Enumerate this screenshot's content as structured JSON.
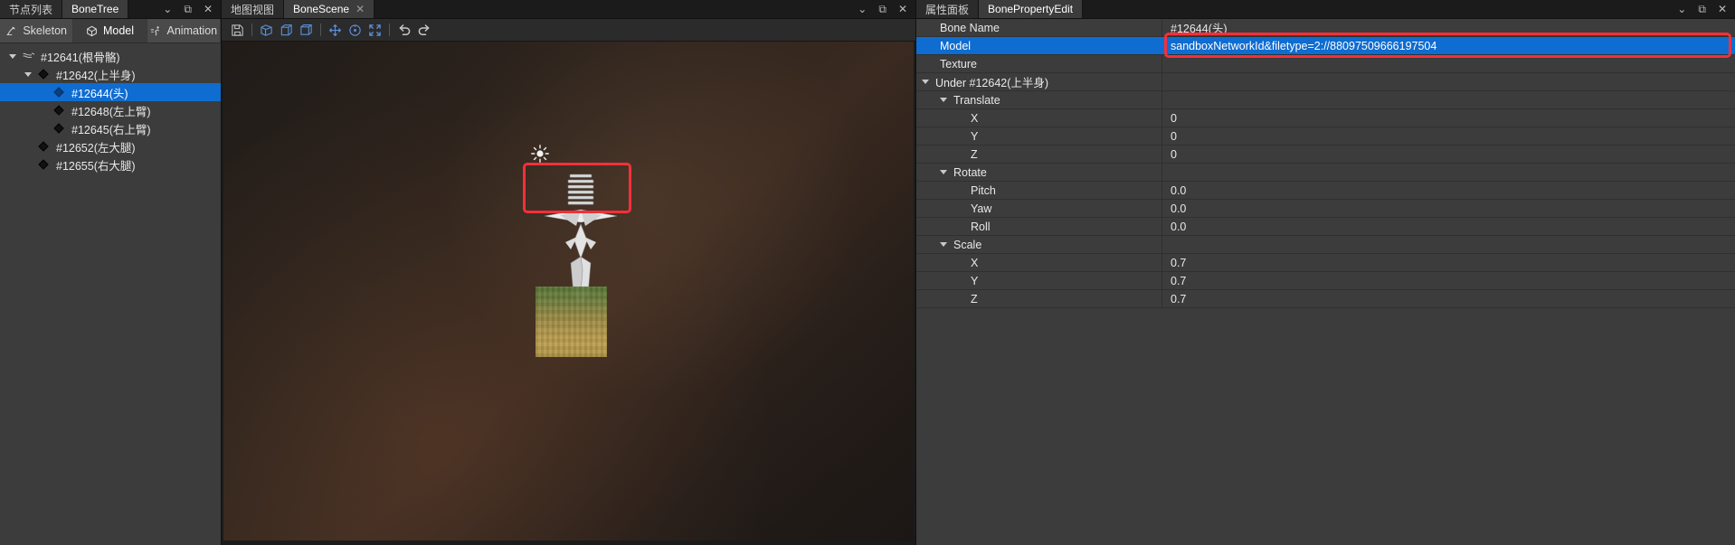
{
  "left_panel": {
    "dock_tabs": [
      {
        "label": "节点列表",
        "active": false
      },
      {
        "label": "BoneTree",
        "active": true
      }
    ],
    "window_buttons": [
      {
        "name": "collapse",
        "glyph": "⌄"
      },
      {
        "name": "float",
        "glyph": "⧉"
      },
      {
        "name": "close",
        "glyph": "✕"
      }
    ],
    "mode_tabs": [
      {
        "label": "Skeleton",
        "icon": "skeleton-icon",
        "active": false
      },
      {
        "label": "Model",
        "icon": "cube-icon",
        "active": true
      },
      {
        "label": "Animation",
        "icon": "run-icon",
        "active": false
      }
    ],
    "tree": [
      {
        "label": "#12641(根骨骼)",
        "depth": 0,
        "icon": "bone-icon",
        "expanded": true,
        "selected": false
      },
      {
        "label": "#12642(上半身)",
        "depth": 1,
        "icon": "diamond-icon",
        "expanded": true,
        "selected": false
      },
      {
        "label": "#12644(头)",
        "depth": 2,
        "icon": "diamond-icon",
        "expanded": false,
        "selected": true
      },
      {
        "label": "#12648(左上臂)",
        "depth": 2,
        "icon": "diamond-icon",
        "expanded": false,
        "selected": false
      },
      {
        "label": "#12645(右上臂)",
        "depth": 2,
        "icon": "diamond-icon",
        "expanded": false,
        "selected": false
      },
      {
        "label": "#12652(左大腿)",
        "depth": 1,
        "icon": "diamond-icon",
        "expanded": false,
        "selected": false
      },
      {
        "label": "#12655(右大腿)",
        "depth": 1,
        "icon": "diamond-icon",
        "expanded": false,
        "selected": false
      }
    ]
  },
  "center_panel": {
    "dock_tabs": [
      {
        "label": "地图视图",
        "active": false,
        "closable": false
      },
      {
        "label": "BoneScene",
        "active": true,
        "closable": true
      }
    ],
    "window_buttons": [
      {
        "name": "collapse",
        "glyph": "⌄"
      },
      {
        "name": "float",
        "glyph": "⧉"
      },
      {
        "name": "close",
        "glyph": "✕"
      }
    ],
    "toolbar": [
      {
        "name": "save-button",
        "icon": "save-icon"
      },
      {
        "name": "separator-1",
        "icon": "separator"
      },
      {
        "name": "view-front-button",
        "icon": "cube-front-icon"
      },
      {
        "name": "view-side-button",
        "icon": "cube-side-icon"
      },
      {
        "name": "view-persp-button",
        "icon": "cube-persp-icon"
      },
      {
        "name": "separator-2",
        "icon": "separator"
      },
      {
        "name": "move-tool-button",
        "icon": "move-arrows-icon"
      },
      {
        "name": "rotate-tool-button",
        "icon": "rotate-icon"
      },
      {
        "name": "scale-tool-button",
        "icon": "expand-icon"
      },
      {
        "name": "separator-3",
        "icon": "separator"
      },
      {
        "name": "undo-button",
        "icon": "undo-arrow-icon"
      },
      {
        "name": "redo-button",
        "icon": "redo-arrow-icon"
      }
    ],
    "scene": {
      "light_gizmo": "sun-icon",
      "selection_highlight_color": "#f4303a",
      "ground_plane": "grass-terrain"
    }
  },
  "right_panel": {
    "dock_tabs": [
      {
        "label": "属性面板",
        "active": false
      },
      {
        "label": "BonePropertyEdit",
        "active": true
      }
    ],
    "window_buttons": [
      {
        "name": "collapse",
        "glyph": "⌄"
      },
      {
        "name": "float",
        "glyph": "⧉"
      },
      {
        "name": "close",
        "glyph": "✕"
      }
    ],
    "properties": [
      {
        "name": "Bone Name",
        "value": "#12644(头)",
        "indent": 1,
        "group": false,
        "selected": false,
        "highlight": false
      },
      {
        "name": "Model",
        "value": "sandboxNetworkId&filetype=2://88097509666197504",
        "indent": 1,
        "group": false,
        "selected": true,
        "highlight": true
      },
      {
        "name": "Texture",
        "value": "",
        "indent": 1,
        "group": false,
        "selected": false,
        "highlight": false
      },
      {
        "name": "Under #12642(上半身)",
        "value": "",
        "indent": 0,
        "group": true,
        "selected": false,
        "highlight": false
      },
      {
        "name": "Translate",
        "value": "",
        "indent": 1,
        "group": true,
        "selected": false,
        "highlight": false
      },
      {
        "name": "X",
        "value": "0",
        "indent": 3,
        "group": false,
        "selected": false,
        "highlight": false
      },
      {
        "name": "Y",
        "value": "0",
        "indent": 3,
        "group": false,
        "selected": false,
        "highlight": false
      },
      {
        "name": "Z",
        "value": "0",
        "indent": 3,
        "group": false,
        "selected": false,
        "highlight": false
      },
      {
        "name": "Rotate",
        "value": "",
        "indent": 1,
        "group": true,
        "selected": false,
        "highlight": false
      },
      {
        "name": "Pitch",
        "value": "0.0",
        "indent": 3,
        "group": false,
        "selected": false,
        "highlight": false
      },
      {
        "name": "Yaw",
        "value": "0.0",
        "indent": 3,
        "group": false,
        "selected": false,
        "highlight": false
      },
      {
        "name": "Roll",
        "value": "0.0",
        "indent": 3,
        "group": false,
        "selected": false,
        "highlight": false
      },
      {
        "name": "Scale",
        "value": "",
        "indent": 1,
        "group": true,
        "selected": false,
        "highlight": false
      },
      {
        "name": "X",
        "value": "0.7",
        "indent": 3,
        "group": false,
        "selected": false,
        "highlight": false
      },
      {
        "name": "Y",
        "value": "0.7",
        "indent": 3,
        "group": false,
        "selected": false,
        "highlight": false
      },
      {
        "name": "Z",
        "value": "0.7",
        "indent": 3,
        "group": false,
        "selected": false,
        "highlight": false
      }
    ]
  },
  "colors": {
    "accent_selection": "#0f6cd0",
    "highlight_outline": "#f4303a",
    "panel_bg": "#3c3c3c",
    "tabbar_bg": "#1b1b1b",
    "viewport_bg": "#241d19"
  }
}
